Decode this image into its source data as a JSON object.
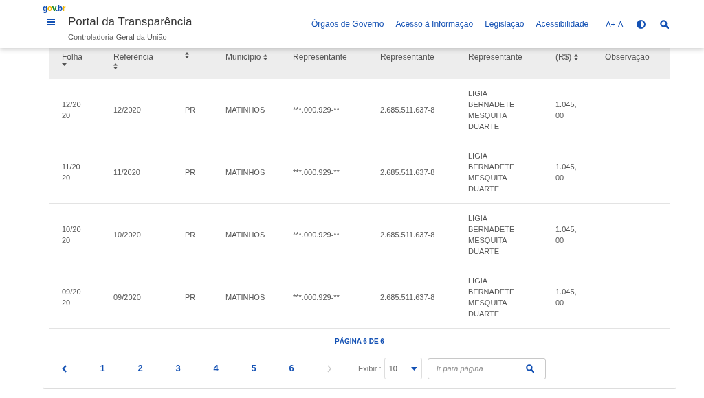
{
  "header": {
    "logo": "gov.br",
    "title": "Portal da Transparência",
    "subtitle": "Controladoria-Geral da União",
    "nav": [
      "Órgãos de Governo",
      "Acesso à Informação",
      "Legislação",
      "Acessibilidade"
    ],
    "font_controls": [
      "A+",
      "A-"
    ]
  },
  "table": {
    "columns": [
      {
        "label": "Folha",
        "kind": "sorted"
      },
      {
        "label": "Referência",
        "kind": "sortable"
      },
      {
        "kind": "sortable"
      },
      {
        "label": "Município",
        "kind": "sortable"
      },
      {
        "label": "Representante",
        "kind": "plain"
      },
      {
        "label": "Representante",
        "kind": "plain"
      },
      {
        "label": "Representante",
        "kind": "plain"
      },
      {
        "label": "(R$)",
        "kind": "sortable"
      },
      {
        "label": "Observação",
        "kind": "plain"
      }
    ],
    "rows": [
      [
        "12/2020",
        "12/2020",
        "PR",
        "MATINHOS",
        "***.000.929-**",
        "2.685.511.637-8",
        "LIGIA BERNADETE MESQUITA DUARTE",
        "1.045,00"
      ],
      [
        "11/2020",
        "11/2020",
        "PR",
        "MATINHOS",
        "***.000.929-**",
        "2.685.511.637-8",
        "LIGIA BERNADETE MESQUITA DUARTE",
        "1.045,00"
      ],
      [
        "10/2020",
        "10/2020",
        "PR",
        "MATINHOS",
        "***.000.929-**",
        "2.685.511.637-8",
        "LIGIA BERNADETE MESQUITA DUARTE",
        "1.045,00"
      ],
      [
        "09/2020",
        "09/2020",
        "PR",
        "MATINHOS",
        "***.000.929-**",
        "2.685.511.637-8",
        "LIGIA BERNADETE MESQUITA DUARTE",
        "1.045,00"
      ]
    ]
  },
  "pagination": {
    "status": "PÁGINA 6 DE 6",
    "prev": {
      "disabled": false
    },
    "pages": [
      "1",
      "2",
      "3",
      "4",
      "5",
      "6"
    ],
    "next": {
      "disabled": true
    },
    "page_size_label": "Exibir :",
    "page_size": "10",
    "goto": {
      "placeholder": "Ir para página"
    }
  }
}
